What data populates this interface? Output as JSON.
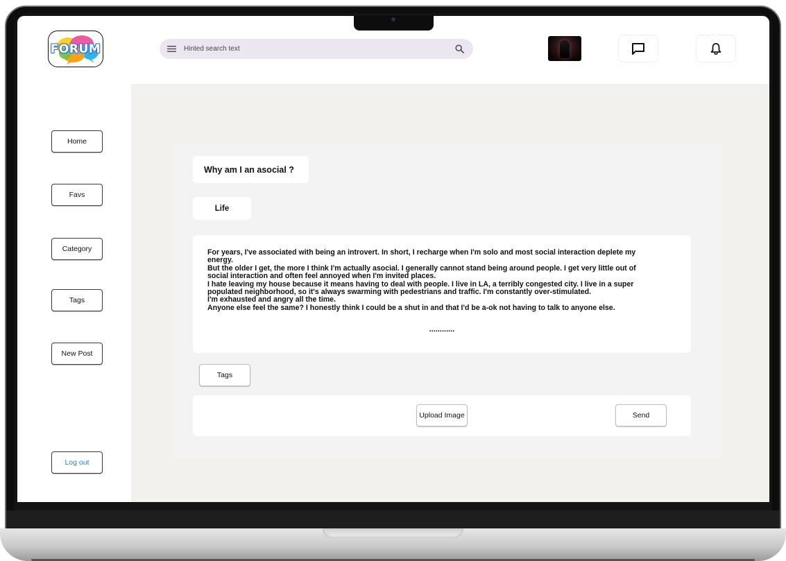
{
  "app": {
    "logo_text": "FORUM"
  },
  "header": {
    "search": {
      "placeholder": "Hinted search text",
      "menu_icon": "menu-icon",
      "search_icon": "search-icon"
    },
    "avatar_icon": "user-avatar",
    "chat_icon": "chat-bubble-icon",
    "notifications_icon": "bell-icon"
  },
  "sidebar": {
    "items": [
      {
        "label": "Home"
      },
      {
        "label": "Favs"
      },
      {
        "label": "Category"
      },
      {
        "label": "Tags"
      },
      {
        "label": "New Post"
      }
    ],
    "logout_label": "Log out"
  },
  "post": {
    "title": "Why am I an asocial ?",
    "category": "Life",
    "body_lines": [
      "For years, I've associated with being an introvert. In short, I recharge when I'm solo and most social interaction deplete my",
      "energy.",
      "But the older I get, the more I think I'm actually asocial. I generally cannot stand being around people. I get very little out of",
      "social interaction and often feel annoyed when I'm invited places.",
      "I hate leaving my house because it means having to deal with people. I live in LA, a terribly congested city. I live in a super",
      "populated neighborhood, so it's always swarming with pedestrians and traffic. I'm constantly over-stimulated.",
      "I'm exhausted and angry all the time.",
      "Anyone else feel the same? I honestly think I could be a shut in and that I'd be a-ok not having to talk to anyone else."
    ],
    "ellipsis": "............",
    "tags_label": "Tags",
    "upload_label": "Upload Image",
    "send_label": "Send"
  },
  "colors": {
    "search_bg": "#ece6f0",
    "main_bg": "#f2f1ee",
    "panel_bg": "#f3f3f3",
    "logout_text": "#2b7fd0"
  }
}
